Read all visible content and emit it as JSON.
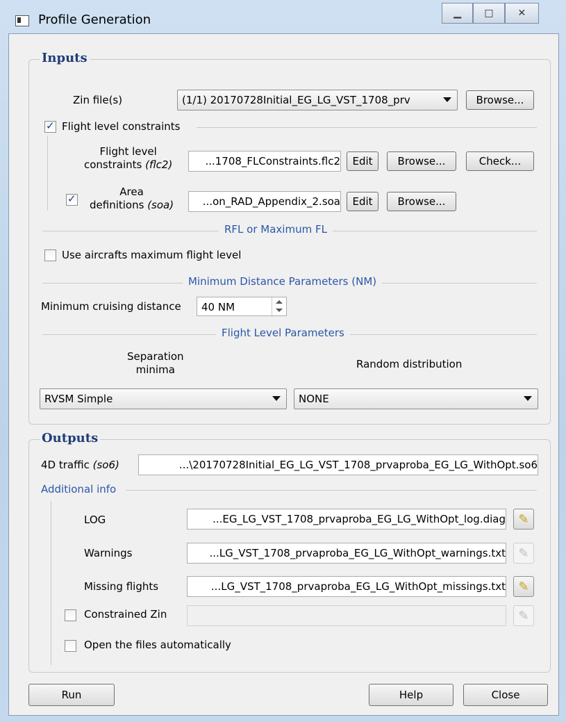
{
  "window": {
    "title": "Profile Generation",
    "caption_buttons": [
      "minimize",
      "maximize",
      "close"
    ]
  },
  "inputs": {
    "group_title": "Inputs",
    "zin_label": "Zin file(s)",
    "zin_value": "(1/1) 20170728Initial_EG_LG_VST_1708_prv",
    "zin_browse": "Browse...",
    "flc_checkbox_label": "Flight level constraints",
    "flc_checked": true,
    "flc_label_line1": "Flight level",
    "flc_label_line2": "constraints",
    "flc_ext": "(flc2)",
    "flc_value": "...1708_FLConstraints.flc2",
    "flc_edit": "Edit",
    "flc_browse": "Browse...",
    "flc_check": "Check...",
    "area_checked": true,
    "area_label_line1": "Area",
    "area_label_line2": "definitions",
    "area_ext": "(soa)",
    "area_value": "...on_RAD_Appendix_2.soa",
    "area_edit": "Edit",
    "area_browse": "Browse...",
    "rfl_section": "RFL or Maximum FL",
    "use_max_fl_label": "Use aircrafts maximum flight level",
    "use_max_fl_checked": false,
    "min_dist_section": "Minimum Distance Parameters (NM)",
    "min_cruise_label": "Minimum cruising distance",
    "min_cruise_value": "40 NM",
    "fl_params_section": "Flight Level Parameters",
    "sep_minima_line1": "Separation",
    "sep_minima_line2": "minima",
    "random_dist_label": "Random distribution",
    "sep_minima_value": "RVSM Simple",
    "random_dist_value": "NONE"
  },
  "outputs": {
    "group_title": "Outputs",
    "traffic_label": "4D traffic",
    "traffic_ext": "(so6)",
    "traffic_value": "...\\20170728Initial_EG_LG_VST_1708_prvaproba_EG_LG_WithOpt.so6",
    "additional_info": "Additional info",
    "log_label": "LOG",
    "log_value": "...EG_LG_VST_1708_prvaproba_EG_LG_WithOpt_log.diag",
    "warnings_label": "Warnings",
    "warnings_value": "...LG_VST_1708_prvaproba_EG_LG_WithOpt_warnings.txt",
    "missing_label": "Missing flights",
    "missing_value": "...LG_VST_1708_prvaproba_EG_LG_WithOpt_missings.txt",
    "constrained_zin_label": "Constrained Zin",
    "constrained_zin_checked": false,
    "open_files_label": "Open the files automatically",
    "open_files_checked": false
  },
  "footer": {
    "run": "Run",
    "help": "Help",
    "close": "Close"
  }
}
